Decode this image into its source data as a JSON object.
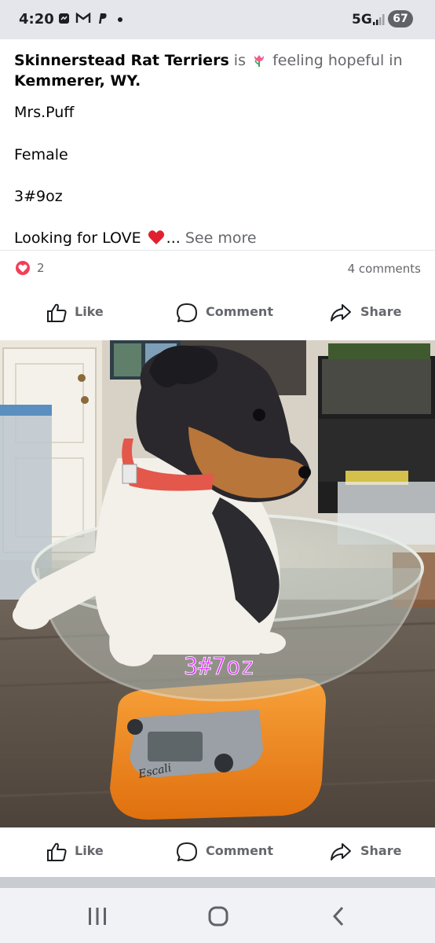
{
  "status_bar": {
    "time": "4:20",
    "notification_icons": [
      "facebook-messenger-icon",
      "gmail-icon",
      "paypal-icon"
    ],
    "network": "5G",
    "battery": "67"
  },
  "post": {
    "author": "Skinnerstead Rat Terriers",
    "is_text": "is",
    "feeling_text": "feeling hopeful in",
    "location": "Kemmerer, WY.",
    "lines": [
      "Mrs.Puff",
      "Female",
      "3#9oz"
    ],
    "last_line": "Looking for LOVE",
    "ellipsis": "...",
    "see_more": "See more"
  },
  "reactions": {
    "count": "2",
    "comments": "4 comments"
  },
  "actions": {
    "like": "Like",
    "comment": "Comment",
    "share": "Share"
  },
  "photo": {
    "overlay_text": "3#7oz",
    "overlay_color": "#e040fb",
    "scale_brand": "Escali",
    "scale_colors": {
      "body": "#f28a1e",
      "display": "#8a8f96"
    }
  },
  "colors": {
    "secondary_text": "#65676b",
    "divider": "#e4e6eb",
    "love": "#f33e58"
  }
}
